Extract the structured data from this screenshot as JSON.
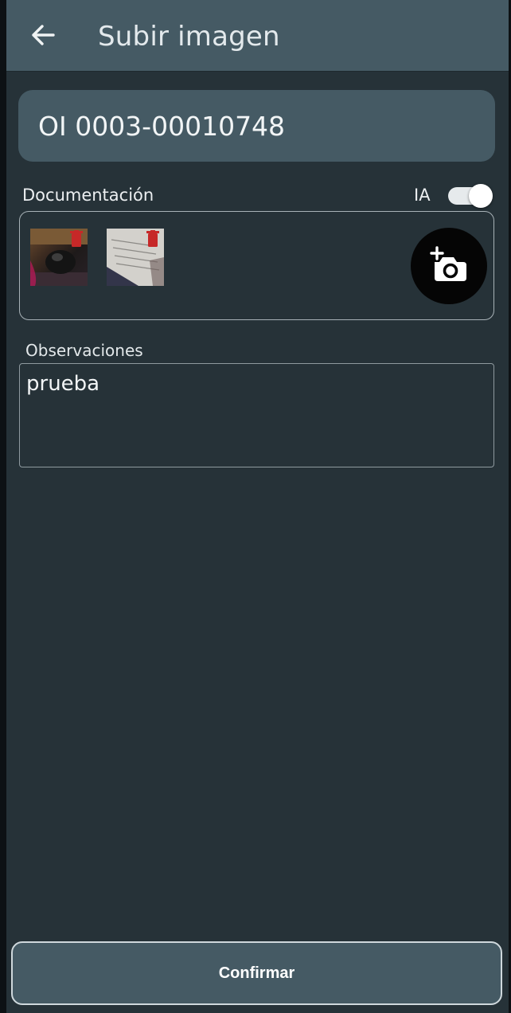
{
  "appbar": {
    "title": "Subir imagen",
    "back_icon": "arrow-left-icon"
  },
  "order": {
    "id": "OI 0003-00010748"
  },
  "documentation": {
    "label": "Documentación",
    "ia_label": "IA",
    "ia_enabled": true,
    "images": [
      {
        "name": "photo-thumbnail-1",
        "delete_icon": "trash-icon"
      },
      {
        "name": "photo-thumbnail-2",
        "delete_icon": "trash-icon"
      }
    ],
    "add_photo_icon": "add-camera-icon"
  },
  "observations": {
    "label": "Observaciones",
    "value": "prueba"
  },
  "footer": {
    "confirm_label": "Confirmar"
  },
  "colors": {
    "appbar": "#455a64",
    "background": "#263238",
    "delete": "#c62828"
  }
}
